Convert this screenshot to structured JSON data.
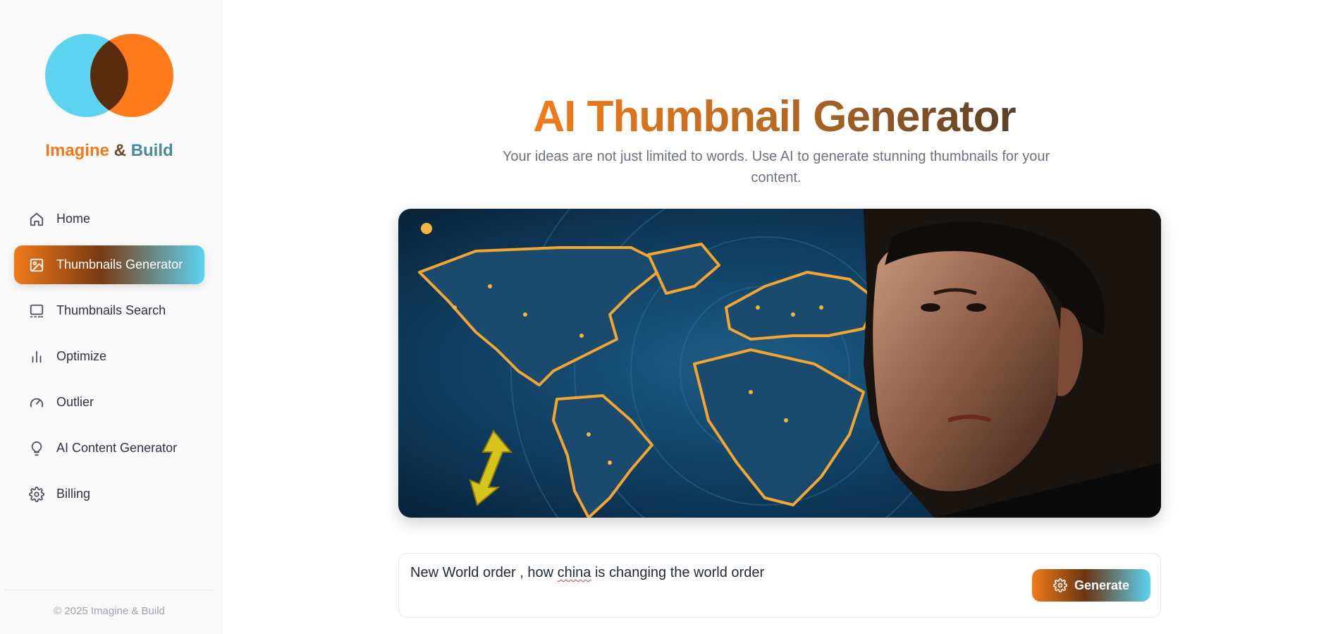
{
  "sidebar": {
    "brand": {
      "part1": "Imagine",
      "part2": " & ",
      "part3": "Build"
    },
    "items": [
      {
        "label": "Home",
        "icon": "home-icon"
      },
      {
        "label": "Thumbnails Generator",
        "icon": "image-icon",
        "active": true
      },
      {
        "label": "Thumbnails Search",
        "icon": "monitor-icon"
      },
      {
        "label": "Optimize",
        "icon": "bar-chart-icon"
      },
      {
        "label": "Outlier",
        "icon": "gauge-icon"
      },
      {
        "label": "AI Content Generator",
        "icon": "lightbulb-icon"
      },
      {
        "label": "Billing",
        "icon": "gear-icon"
      }
    ],
    "copyright": "© 2025 Imagine & Build"
  },
  "main": {
    "title": "AI Thumbnail Generator",
    "subtitle": "Your ideas are not just limited to words. Use AI to generate stunning thumbnails for your content.",
    "prompt": {
      "before": "New World order , how ",
      "misspelled": "china",
      "after": " is changing the world order"
    },
    "generate_label": "Generate"
  },
  "colors": {
    "accent_orange": "#f07a1a",
    "accent_brown": "#6b4a2a",
    "accent_cyan": "#5bd3f1",
    "logo_left": "#5bd3f1",
    "logo_right": "#ff7a1a",
    "logo_overlap": "#5a2c0e"
  }
}
